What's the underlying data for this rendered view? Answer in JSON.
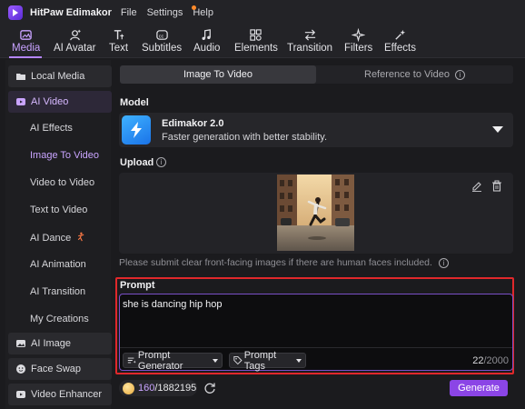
{
  "app": {
    "title": "HitPaw Edimakor",
    "menu": [
      "File",
      "Settings",
      "Help"
    ]
  },
  "toolbar": {
    "tools": [
      {
        "label": "Media",
        "icon": "media-icon",
        "active": true
      },
      {
        "label": "AI Avatar",
        "icon": "avatar-icon"
      },
      {
        "label": "Text",
        "icon": "text-icon"
      },
      {
        "label": "Subtitles",
        "icon": "subtitles-icon"
      },
      {
        "label": "Audio",
        "icon": "audio-icon"
      },
      {
        "label": "Elements",
        "icon": "elements-icon"
      },
      {
        "label": "Transition",
        "icon": "transition-icon"
      },
      {
        "label": "Filters",
        "icon": "filters-icon"
      },
      {
        "label": "Effects",
        "icon": "effects-icon"
      }
    ]
  },
  "sidebar": {
    "local_media": "Local Media",
    "ai_video": "AI Video",
    "sub_items": [
      "AI Effects",
      "Image To Video",
      "Video to Video",
      "Text to Video",
      "AI Dance",
      "AI Animation",
      "AI Transition",
      "My Creations"
    ],
    "active_sub": "Image To Video",
    "ai_image": "AI Image",
    "face_swap": "Face Swap",
    "video_enhancer": "Video Enhancer"
  },
  "tabs": {
    "image_to_video": "Image To Video",
    "reference_to_video": "Reference to Video"
  },
  "model": {
    "section_label": "Model",
    "name": "Edimakor 2.0",
    "description": "Faster generation with better stability."
  },
  "upload": {
    "section_label": "Upload",
    "hint": "Please submit clear front-facing images if there are human faces included."
  },
  "prompt": {
    "section_label": "Prompt",
    "text": "she is dancing hip hop",
    "generator_label": "Prompt Generator",
    "tags_label": "Prompt Tags",
    "count": "22",
    "max": "/2000"
  },
  "credits": {
    "used": "160",
    "total": "/1882195"
  },
  "generate_label": "Generate",
  "colors": {
    "accent": "#8b45e6",
    "active_text": "#c9a4ff",
    "highlight_frame": "#e0282b"
  }
}
